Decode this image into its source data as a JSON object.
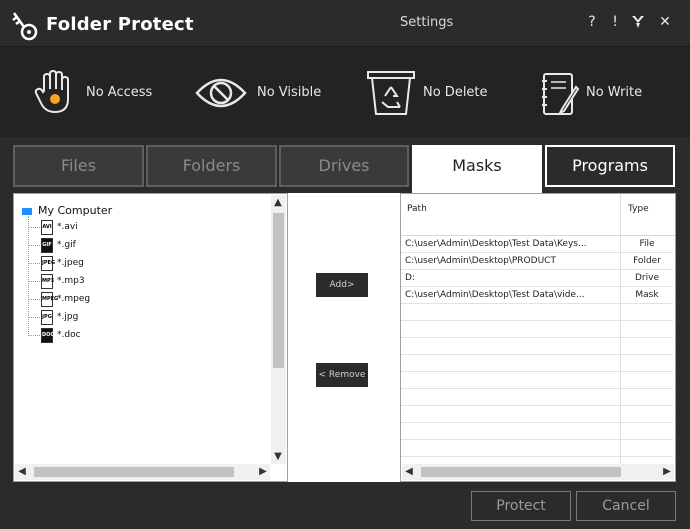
{
  "app": {
    "title": "Folder Protect",
    "settings": "Settings",
    "help": "?",
    "info": "!",
    "minimize": "⮟",
    "close": "✕"
  },
  "protection": [
    {
      "label": "No Access",
      "icon": "hand-icon"
    },
    {
      "label": "No Visible",
      "icon": "eye-slash-icon"
    },
    {
      "label": "No Delete",
      "icon": "recycle-bin-icon"
    },
    {
      "label": "No Write",
      "icon": "notebook-pen-icon"
    }
  ],
  "tabs": [
    "Files",
    "Folders",
    "Drives",
    "Masks",
    "Programs"
  ],
  "tree": {
    "root": "My Computer",
    "items": [
      {
        "label": "*.avi",
        "badge": "AVI"
      },
      {
        "label": "*.gif",
        "badge": "GIF"
      },
      {
        "label": "*.jpeg",
        "badge": "JPEG"
      },
      {
        "label": "*.mp3",
        "badge": "MP3"
      },
      {
        "label": "*.mpeg",
        "badge": "MPEG"
      },
      {
        "label": "*.jpg",
        "badge": "JPG"
      },
      {
        "label": "*.doc",
        "badge": "DOC"
      }
    ]
  },
  "buttons": {
    "add": "Add>",
    "remove": "< Remove",
    "protect": "Protect",
    "cancel": "Cancel"
  },
  "grid": {
    "headers": {
      "path": "Path",
      "type": "Type"
    },
    "rows": [
      {
        "path": "C:\\user\\Admin\\Desktop\\Test Data\\Keys...",
        "type": "File"
      },
      {
        "path": "C:\\user\\Admin\\Desktop\\PRODUCT",
        "type": "Folder"
      },
      {
        "path": "D:",
        "type": "Drive"
      },
      {
        "path": "C:\\user\\Admin\\Desktop\\Test Data\\vide...",
        "type": "Mask"
      }
    ]
  },
  "colors": {
    "accent": "#f5a623",
    "background": "#2b2b2b",
    "protection_bar": "#232323"
  }
}
